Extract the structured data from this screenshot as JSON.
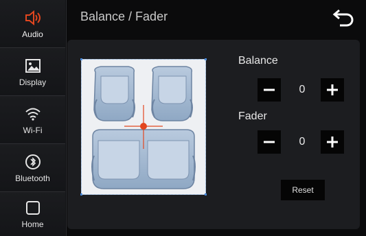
{
  "sidebar": {
    "items": [
      {
        "label": "Audio",
        "icon": "speaker-icon",
        "active": true
      },
      {
        "label": "Display",
        "icon": "image-icon"
      },
      {
        "label": "Wi-Fi",
        "icon": "wifi-icon"
      },
      {
        "label": "Bluetooth",
        "icon": "bluetooth-icon"
      },
      {
        "label": "Home",
        "icon": "home-icon"
      }
    ]
  },
  "header": {
    "title": "Balance / Fader"
  },
  "controls": {
    "balance": {
      "label": "Balance",
      "value": "0"
    },
    "fader": {
      "label": "Fader",
      "value": "0"
    },
    "reset_label": "Reset"
  },
  "colors": {
    "accent": "#e2461f",
    "crosshair": "#e2461f",
    "panel": "#1c1d20"
  }
}
